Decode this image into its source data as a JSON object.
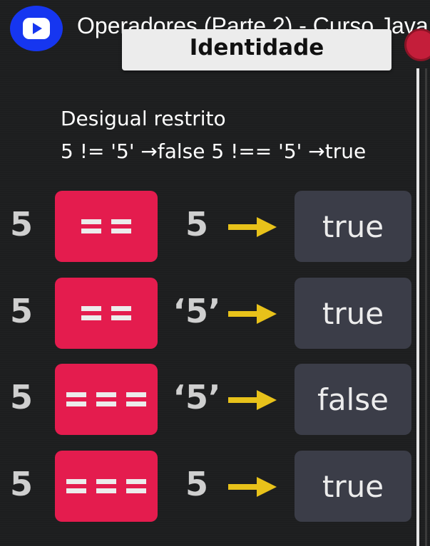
{
  "video": {
    "title": "Operadores (Parte 2) - Curso Java",
    "logo_icon": "play-icon",
    "brand_color": "#1636f0"
  },
  "slide": {
    "heading": "Identidade",
    "description_line1": "Desigual restrito",
    "description_line2": "5 != '5' →false  5 !== '5' →true",
    "colors": {
      "operator_box": "#e41c4e",
      "result_box": "#3b3d48",
      "arrow": "#e8c21a"
    },
    "rows": [
      {
        "left": "5",
        "operator": "==",
        "operator_bars": 2,
        "right": "5",
        "result": "true"
      },
      {
        "left": "5",
        "operator": "==",
        "operator_bars": 2,
        "right": "‘5’",
        "result": "true"
      },
      {
        "left": "5",
        "operator": "===",
        "operator_bars": 3,
        "right": "‘5’",
        "result": "false"
      },
      {
        "left": "5",
        "operator": "===",
        "operator_bars": 3,
        "right": "5",
        "result": "true"
      }
    ]
  }
}
